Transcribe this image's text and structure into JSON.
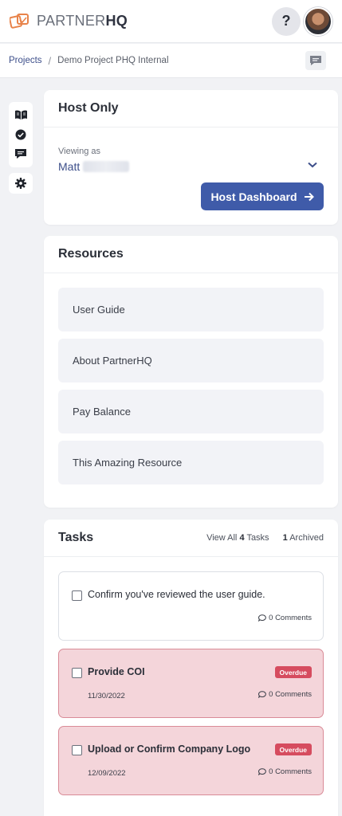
{
  "app": {
    "brand_light": "PARTNER",
    "brand_bold": "HQ",
    "help_label": "?",
    "colors": {
      "accent": "#3f5ba9",
      "overdue": "#d64c5f",
      "overdue_bg": "#f4d5da"
    }
  },
  "breadcrumb": {
    "root": "Projects",
    "separator": "/",
    "current": "Demo Project PHQ Internal"
  },
  "sidebar": {
    "icons": [
      "book-icon",
      "check-circle-icon",
      "comment-icon",
      "gear-icon"
    ]
  },
  "host_card": {
    "title": "Host Only",
    "viewing_label": "Viewing as",
    "viewing_name": "Matt",
    "button_label": "Host Dashboard"
  },
  "resources": {
    "title": "Resources",
    "items": [
      {
        "label": "User Guide"
      },
      {
        "label": "About PartnerHQ"
      },
      {
        "label": "Pay Balance"
      },
      {
        "label": "This Amazing Resource"
      }
    ]
  },
  "tasks": {
    "title": "Tasks",
    "view_all_prefix": "View All",
    "total_count": "4",
    "view_all_suffix": "Tasks",
    "archived_count": "1",
    "archived_label": "Archived",
    "items": [
      {
        "title": "Confirm you've reviewed the user guide.",
        "due": "",
        "badge": "",
        "comments": "0 Comments",
        "overdue": false
      },
      {
        "title": "Provide COI",
        "due": "11/30/2022",
        "badge": "Overdue",
        "comments": "0 Comments",
        "overdue": true
      },
      {
        "title": "Upload or Confirm Company Logo",
        "due": "12/09/2022",
        "badge": "Overdue",
        "comments": "0 Comments",
        "overdue": true
      }
    ]
  }
}
